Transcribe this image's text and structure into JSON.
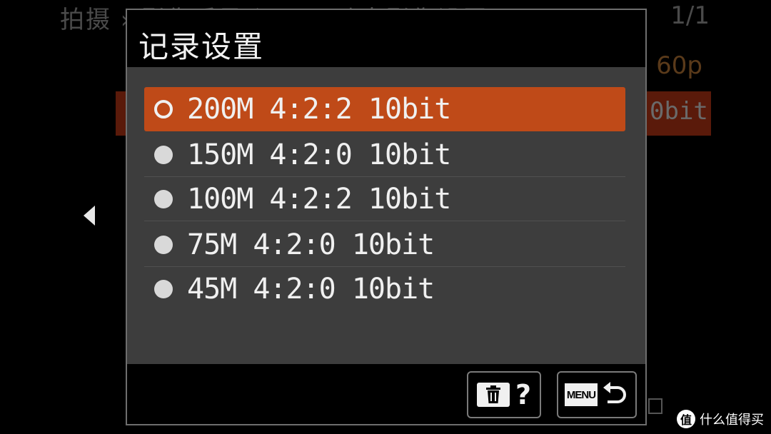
{
  "background_menu": {
    "title": "拍摄 › 影像质量/记录 › 动态影像设置",
    "page": "1/1",
    "value_1": "60p",
    "value_2": "0bit"
  },
  "dialog": {
    "title": "记录设置",
    "options": [
      {
        "label": "200M 4:2:2 10bit",
        "selected": true
      },
      {
        "label": "150M 4:2:0 10bit",
        "selected": false
      },
      {
        "label": "100M 4:2:2 10bit",
        "selected": false
      },
      {
        "label": "75M 4:2:0 10bit",
        "selected": false
      },
      {
        "label": "45M 4:2:0 10bit",
        "selected": false
      }
    ],
    "footer": {
      "delete_help_label": "?",
      "menu_label": "MENU"
    }
  },
  "watermark": {
    "logo_char": "值",
    "text": "什么值得买"
  },
  "colors": {
    "selection": "#bf4a18",
    "list_bg": "#3d3d3d",
    "text": "#f0f0f0"
  },
  "icons": {
    "left": "left-arrow-icon",
    "delete": "trash-icon",
    "back": "return-arrow-icon"
  }
}
